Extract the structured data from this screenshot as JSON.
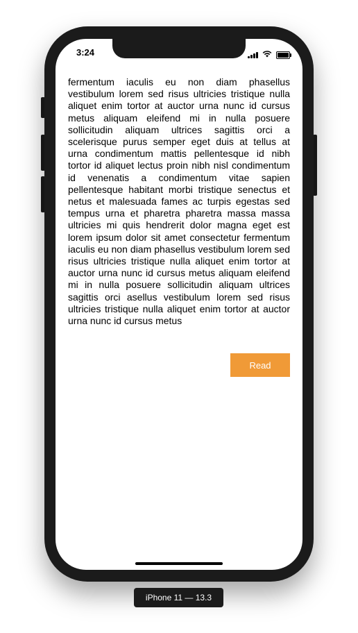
{
  "status_bar": {
    "time": "3:24",
    "icons": [
      "signal-icon",
      "wifi-icon",
      "battery-icon"
    ]
  },
  "content": {
    "paragraph": "fermentum iaculis eu non diam phasellus vestibulum lorem sed risus ultricies tristique nulla aliquet enim tortor at auctor urna nunc id cursus metus aliquam eleifend mi in nulla posuere sollicitudin aliquam ultrices sagittis orci a scelerisque purus semper eget duis at tellus at urna condimentum mattis pellentesque id nibh tortor id aliquet lectus proin nibh nisl condimentum id venenatis a condimentum vitae sapien pellentesque habitant morbi tristique senectus et netus et malesuada fames ac turpis egestas sed tempus urna et pharetra pharetra massa massa ultricies mi quis hendrerit dolor magna eget est lorem ipsum dolor sit amet consectetur fermentum iaculis eu non diam phasellus vestibulum lorem sed risus ultricies tristique nulla aliquet enim tortor at auctor urna nunc id cursus metus aliquam eleifend mi in nulla posuere sollicitudin aliquam ultrices sagittis orci asellus vestibulum lorem sed risus ultricies tristique nulla aliquet enim tortor at auctor urna nunc id cursus metus",
    "read_button_label": "Read"
  },
  "device_label": "iPhone 11 — 13.3",
  "colors": {
    "accent": "#f09a37",
    "frame": "#1b1b1b"
  }
}
